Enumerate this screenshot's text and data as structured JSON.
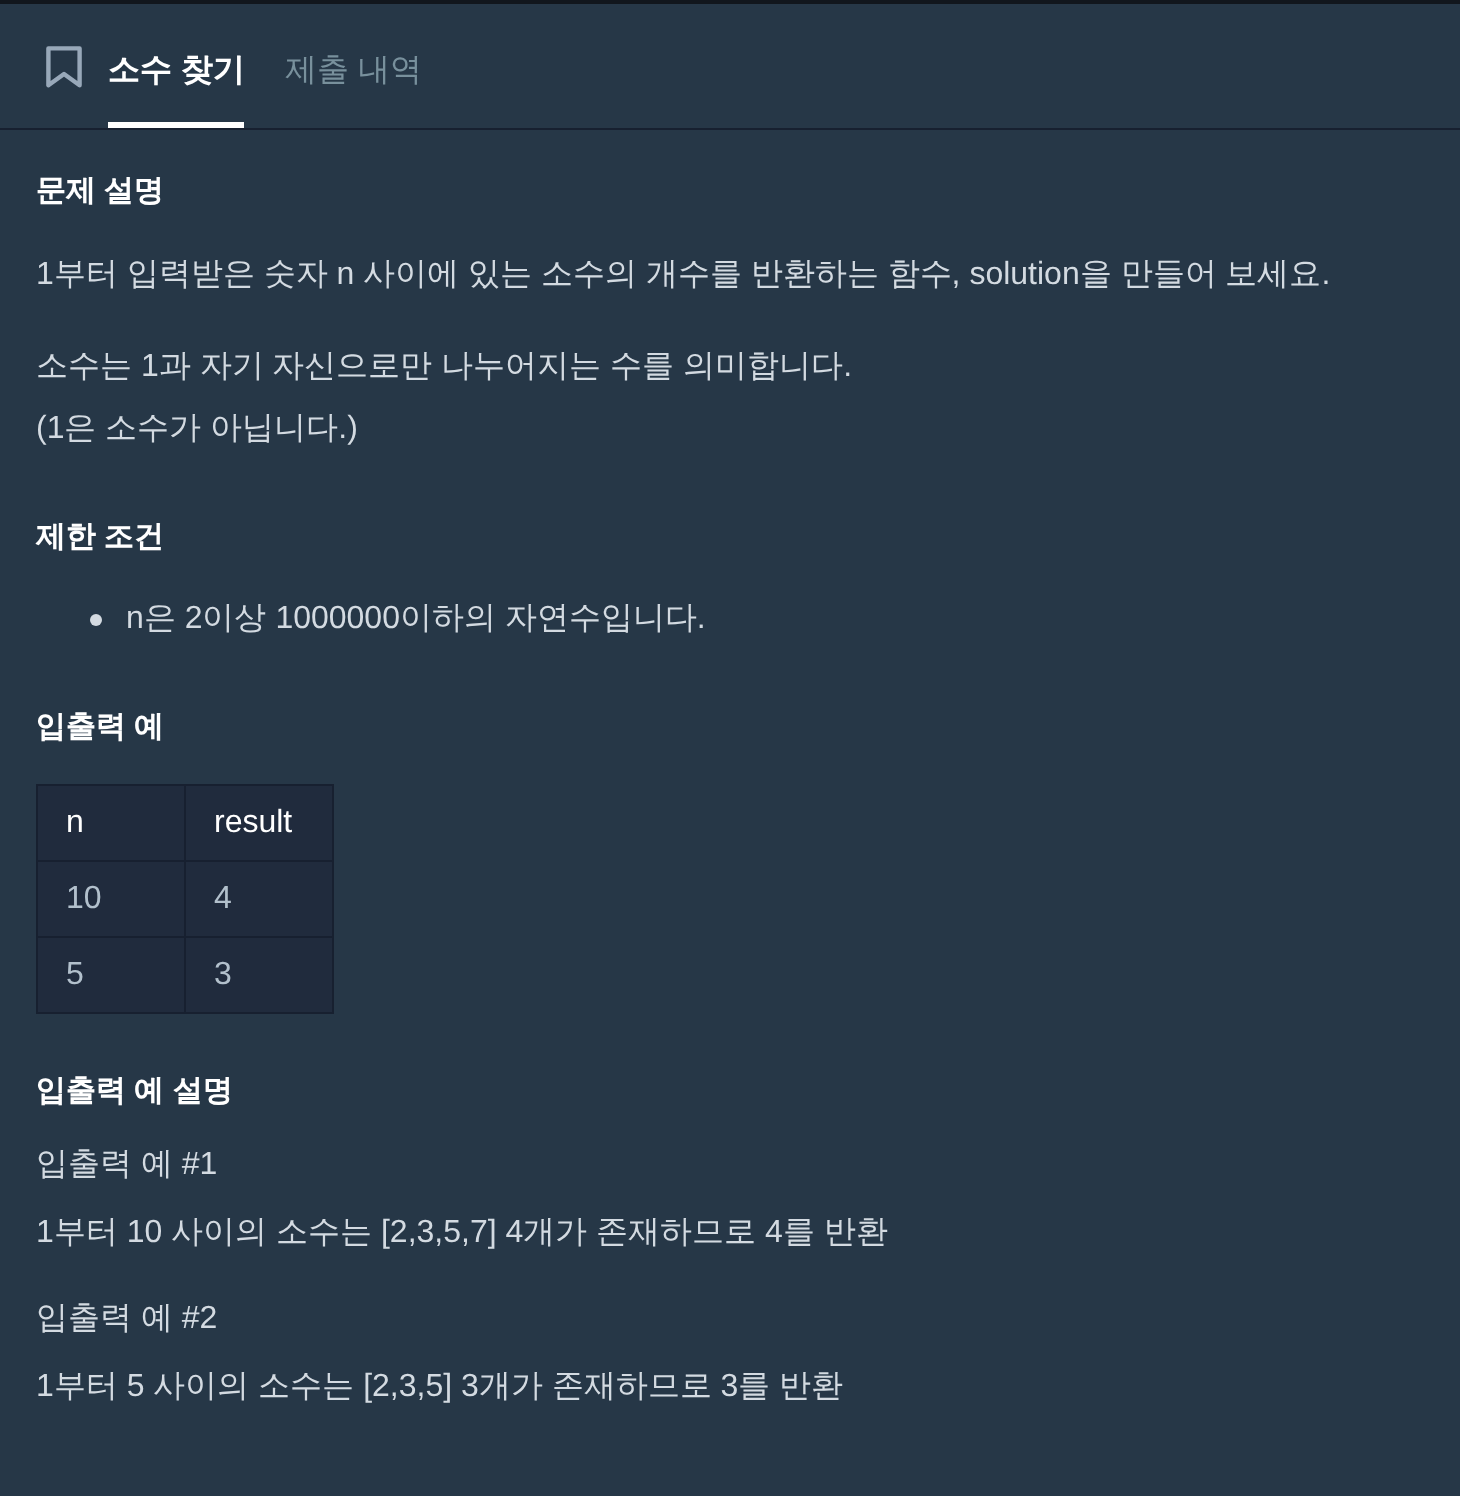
{
  "tabs": [
    {
      "label": "소수 찾기",
      "selected": true
    },
    {
      "label": "제출 내역",
      "selected": false
    }
  ],
  "sections": [
    {
      "heading": "문제 설명",
      "blocks": [
        {
          "kind": "paragraph",
          "lines": [
            "1부터 입력받은 숫자 n 사이에 있는 소수의 개수를 반환하는 함수, solution을 만들어 보세요."
          ]
        },
        {
          "kind": "paragraph",
          "lines": [
            "소수는 1과 자기 자신으로만 나누어지는 수를 의미합니다.",
            "(1은 소수가 아닙니다.)"
          ]
        }
      ]
    },
    {
      "heading": "제한 조건",
      "blocks": [
        {
          "kind": "list",
          "items": [
            "n은 2이상 1000000이하의 자연수입니다."
          ]
        }
      ]
    },
    {
      "heading": "입출력 예",
      "blocks": [
        {
          "kind": "table",
          "columns": [
            "n",
            "result"
          ],
          "rows": [
            [
              "10",
              "4"
            ],
            [
              "5",
              "3"
            ]
          ]
        }
      ]
    },
    {
      "heading": "입출력 예 설명",
      "blocks": [
        {
          "kind": "paragraph",
          "lines": [
            "입출력 예 #1",
            "1부터 10 사이의 소수는 [2,3,5,7] 4개가 존재하므로 4를 반환"
          ]
        },
        {
          "kind": "paragraph",
          "lines": [
            "입출력 예 #2",
            "1부터 5 사이의 소수는 [2,3,5] 3개가 존재하므로 3를 반환"
          ]
        }
      ]
    }
  ]
}
